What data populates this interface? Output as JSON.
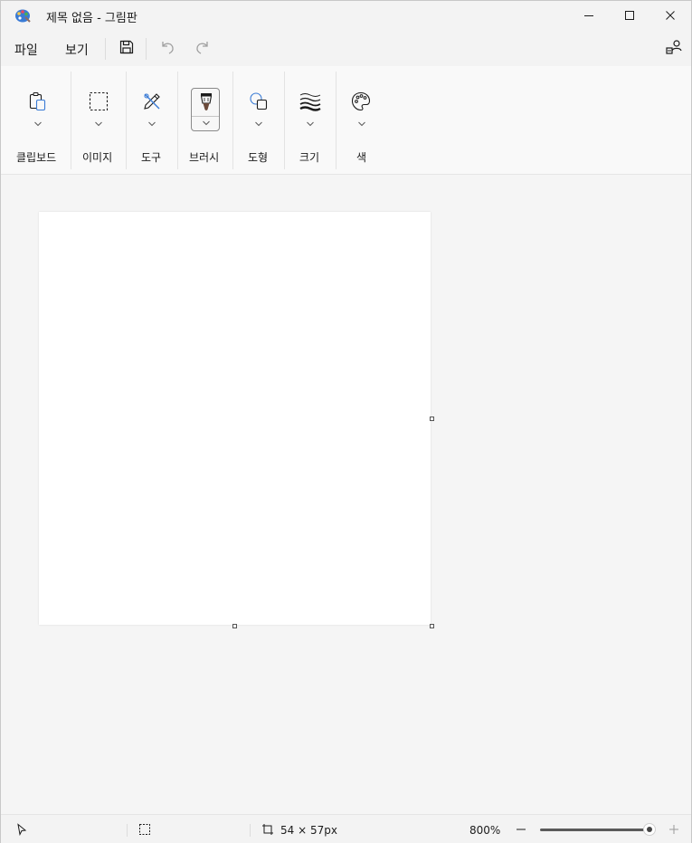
{
  "window": {
    "title": "제목 없음 - 그림판",
    "app_icon": "paint-palette-icon",
    "controls": [
      "minimize-icon",
      "maximize-icon",
      "close-icon"
    ]
  },
  "menu": {
    "file_label": "파일",
    "view_label": "보기",
    "icons": [
      "save-icon",
      "undo-icon",
      "redo-icon",
      "account-icon"
    ]
  },
  "ribbon": {
    "groups": [
      {
        "label": "클립보드",
        "icon": "clipboard-icon"
      },
      {
        "label": "이미지",
        "icon": "select-rectangle-icon"
      },
      {
        "label": "도구",
        "icon": "pencil-icon"
      },
      {
        "label": "브러시",
        "icon": "brush-icon",
        "selected": true
      },
      {
        "label": "도형",
        "icon": "shapes-icon"
      },
      {
        "label": "크기",
        "icon": "stroke-size-icon"
      },
      {
        "label": "색",
        "icon": "palette-icon"
      }
    ]
  },
  "status": {
    "canvas_size": "54 × 57px",
    "zoom": "800%",
    "zoom_level": 0.95,
    "icons": [
      "pointer-icon",
      "selection-icon",
      "canvas-size-icon",
      "zoom-out-icon",
      "zoom-in-icon"
    ]
  },
  "colors": {
    "background": "#f9f9f9",
    "canvas": "#ffffff",
    "text": "#1b1b1b"
  }
}
